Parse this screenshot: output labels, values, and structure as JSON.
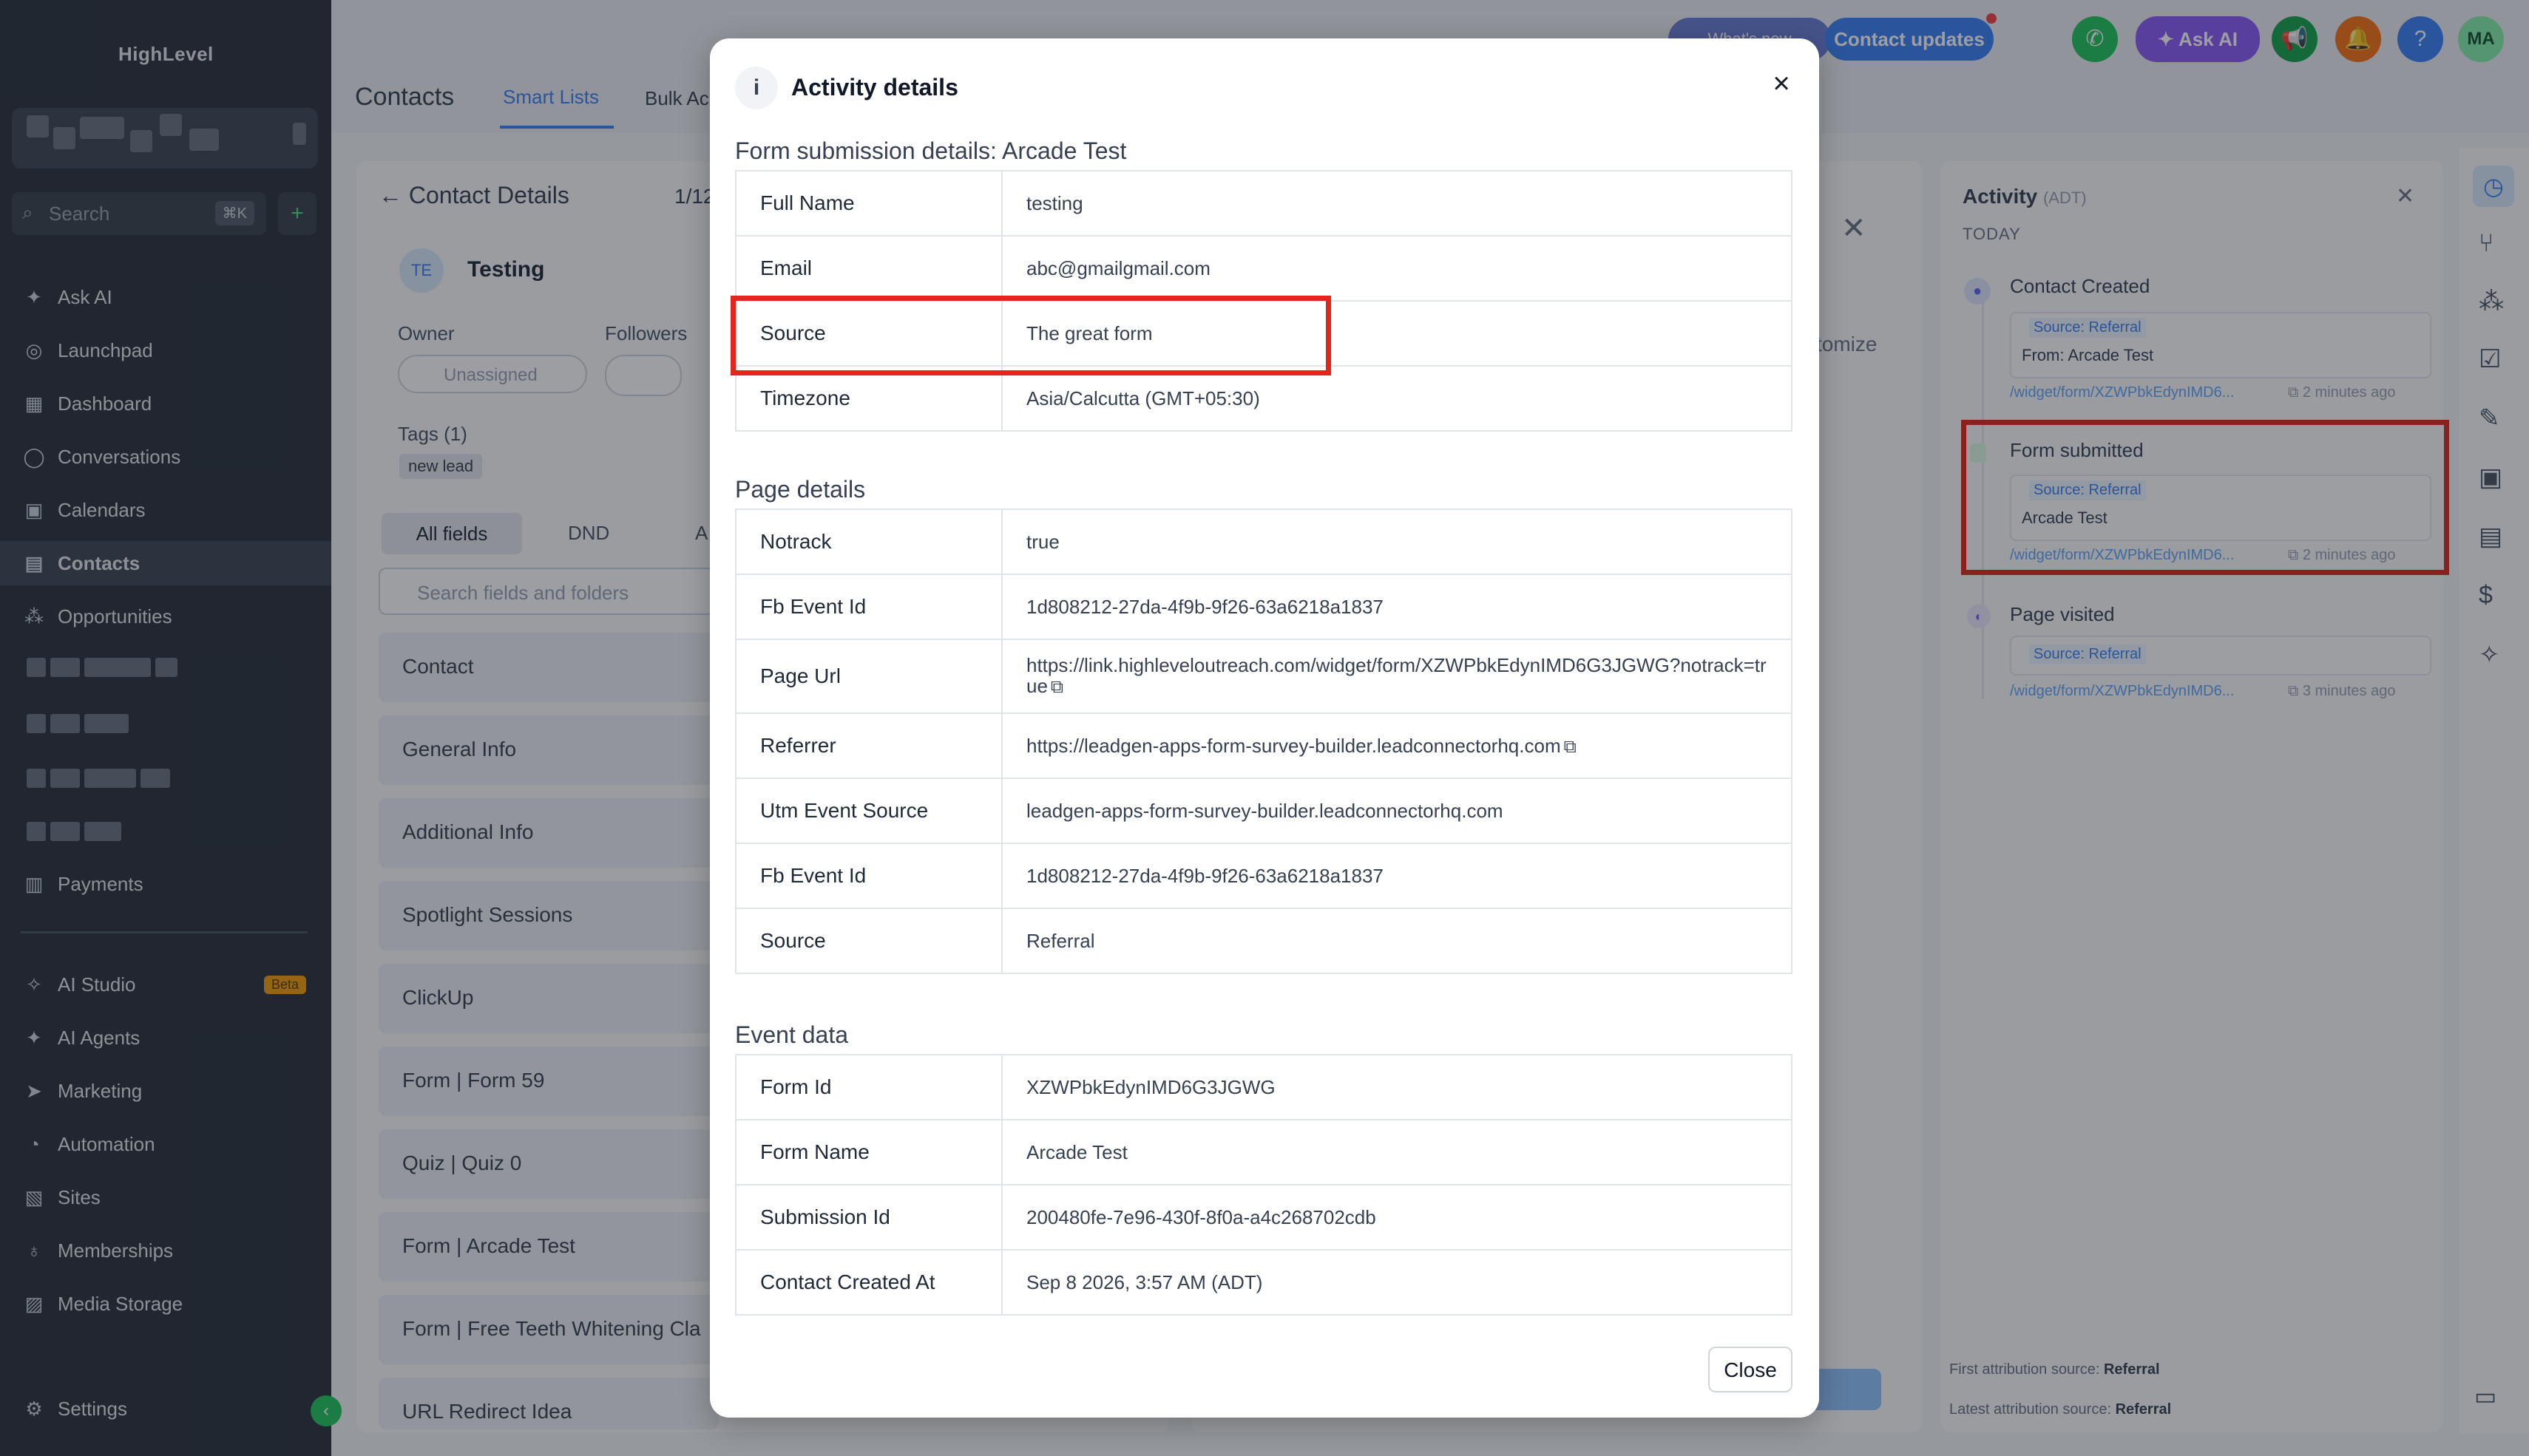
{
  "app": {
    "logo": "HighLevel"
  },
  "sidebar": {
    "search_placeholder": "Search",
    "search_shortcut": "⌘K",
    "items": [
      {
        "label": "Ask AI",
        "icon": "sparkle-icon"
      },
      {
        "label": "Launchpad",
        "icon": "rocket-icon"
      },
      {
        "label": "Dashboard",
        "icon": "dashboard-icon"
      },
      {
        "label": "Conversations",
        "icon": "chat-icon"
      },
      {
        "label": "Calendars",
        "icon": "calendar-icon"
      },
      {
        "label": "Contacts",
        "icon": "contacts-icon"
      },
      {
        "label": "Opportunities",
        "icon": "opportunities-icon"
      },
      {
        "label": "Payments",
        "icon": "payments-icon"
      },
      {
        "label": "AI Studio",
        "icon": "ai-studio-icon",
        "badge": "Beta"
      },
      {
        "label": "AI Agents",
        "icon": "ai-agents-icon"
      },
      {
        "label": "Marketing",
        "icon": "send-icon"
      },
      {
        "label": "Automation",
        "icon": "automation-icon"
      },
      {
        "label": "Sites",
        "icon": "sites-icon"
      },
      {
        "label": "Memberships",
        "icon": "memberships-icon"
      },
      {
        "label": "Media Storage",
        "icon": "media-icon"
      },
      {
        "label": "Settings",
        "icon": "gear-icon"
      }
    ]
  },
  "topbar": {
    "tabs": [
      "Contacts",
      "Smart Lists",
      "Bulk Ac"
    ],
    "whats_new": "What's new",
    "contact_updates": "Contact updates",
    "ask_ai": "Ask AI",
    "avatar": "MA"
  },
  "contact": {
    "header": "Contact Details",
    "pager": "1/12",
    "initials": "TE",
    "name": "Testing",
    "owner_label": "Owner",
    "owner_value": "Unassigned",
    "followers_label": "Followers",
    "tags_label": "Tags (1)",
    "tag": "new lead",
    "tabs": [
      "All fields",
      "DND",
      "A"
    ],
    "search_placeholder": "Search fields and folders",
    "sections": [
      "Contact",
      "General Info",
      "Additional Info",
      "Spotlight Sessions",
      "ClickUp",
      "Form | Form 59",
      "Quiz | Quiz 0",
      "Form | Arcade Test",
      "Form | Free Teeth Whitening Cla",
      "URL Redirect Idea"
    ],
    "customize": "tomize"
  },
  "activity": {
    "title": "Activity",
    "tz": "(ADT)",
    "today": "TODAY",
    "items": [
      {
        "title": "Contact Created",
        "source": "Source: Referral",
        "detail": "From: Arcade Test",
        "url": "/widget/form/XZWPbkEdynIMD6...",
        "time": "2 minutes ago"
      },
      {
        "title": "Form submitted",
        "source": "Source: Referral",
        "detail": "Arcade Test",
        "url": "/widget/form/XZWPbkEdynIMD6...",
        "time": "2 minutes ago"
      },
      {
        "title": "Page visited",
        "source": "Source: Referral",
        "detail": "",
        "url": "/widget/form/XZWPbkEdynIMD6...",
        "time": "3 minutes ago"
      }
    ],
    "first_attr_label": "First attribution source:",
    "first_attr_value": "Referral",
    "latest_attr_label": "Latest attribution source:",
    "latest_attr_value": "Referral"
  },
  "modal": {
    "title": "Activity details",
    "form_section": "Form submission details: Arcade Test",
    "form_rows": [
      {
        "k": "Full Name",
        "v": "testing"
      },
      {
        "k": "Email",
        "v": "abc@gmailgmail.com"
      },
      {
        "k": "Source",
        "v": "The great form"
      },
      {
        "k": "Timezone",
        "v": "Asia/Calcutta (GMT+05:30)"
      }
    ],
    "page_section": "Page details",
    "page_rows": [
      {
        "k": "Notrack",
        "v": "true"
      },
      {
        "k": "Fb Event Id",
        "v": "1d808212-27da-4f9b-9f26-63a6218a1837"
      },
      {
        "k": "Page Url",
        "v": "https://link.highleveloutreach.com/widget/form/XZWPbkEdynIMD6G3JGWG?notrack=true"
      },
      {
        "k": "Referrer",
        "v": "https://leadgen-apps-form-survey-builder.leadconnectorhq.com"
      },
      {
        "k": "Utm Event Source",
        "v": "leadgen-apps-form-survey-builder.leadconnectorhq.com"
      },
      {
        "k": "Fb Event Id",
        "v": "1d808212-27da-4f9b-9f26-63a6218a1837"
      },
      {
        "k": "Source",
        "v": "Referral"
      }
    ],
    "event_section": "Event data",
    "event_rows": [
      {
        "k": "Form Id",
        "v": "XZWPbkEdynIMD6G3JGWG"
      },
      {
        "k": "Form Name",
        "v": "Arcade Test"
      },
      {
        "k": "Submission Id",
        "v": "200480fe-7e96-430f-8f0a-a4c268702cdb"
      },
      {
        "k": "Contact Created At",
        "v": "Sep 8 2026, 3:57 AM (ADT)"
      }
    ],
    "close_label": "Close"
  },
  "colors": {
    "highlight": "#e3261d",
    "sidebar": "#2b313c",
    "accent": "#3b82f6"
  }
}
